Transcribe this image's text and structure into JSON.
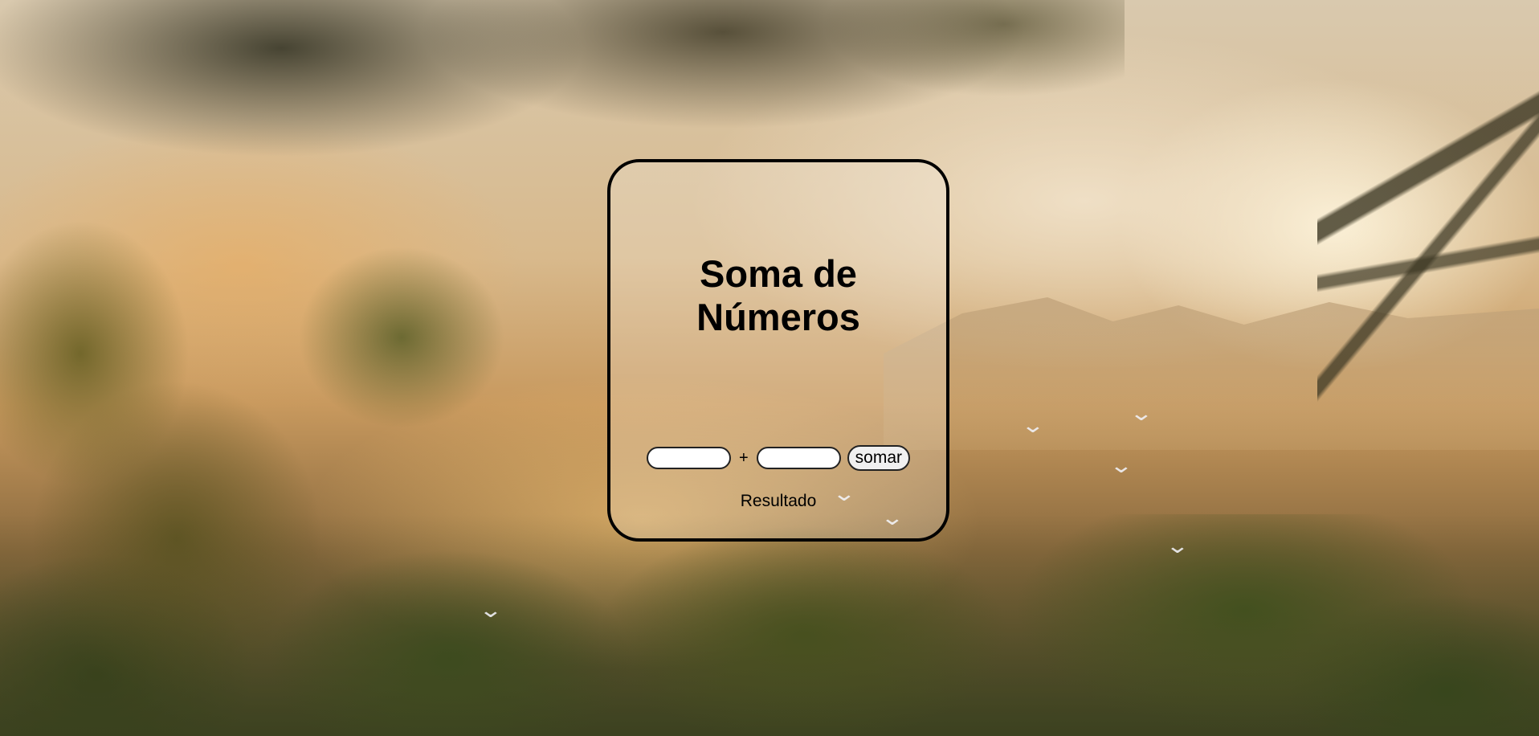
{
  "page": {
    "title_line1": "Soma de",
    "title_line2": "Números"
  },
  "form": {
    "first_value": "",
    "second_value": "",
    "operator": "+",
    "submit_label": "somar"
  },
  "result": {
    "text": "Resultado"
  },
  "colors": {
    "card_border": "#000000",
    "text": "#000000",
    "button_bg": "#f0f0f0"
  },
  "background": {
    "description_icon": "jungle-sunset-image"
  }
}
